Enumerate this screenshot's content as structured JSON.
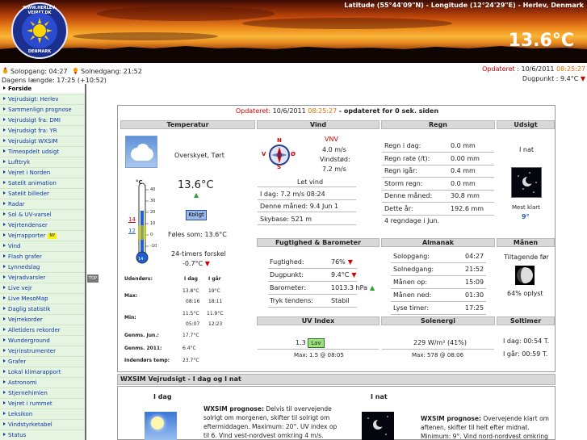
{
  "header": {
    "logo_top": "WWW.HERLEV-VEJRET.DK",
    "logo_bottom": "DENMARK",
    "geo": "Latitude (55°44'09\"N) - Longitude (12°24'29\"E) - Herlev, Denmark",
    "big_temp": "13.6°C"
  },
  "sunbar": {
    "sunrise": "Solopgang: 04:27",
    "sunset": "Solnedgang: 21:52",
    "daylength": "Dagens længde: 17:25 (+10:52)",
    "updated_label": "Opdateret :",
    "updated_date": "10/6/2011",
    "updated_time": "08:25:27",
    "dewpoint": "Dugpunkt : 9.4°C"
  },
  "sidebar": {
    "items": [
      {
        "label": "Forside",
        "active": true
      },
      {
        "label": "Vejrudsigt: Herlev"
      },
      {
        "label": "Sammenlign prognose"
      },
      {
        "label": "Vejrudsigt fra: DMI"
      },
      {
        "label": "Vejrudsigt fra: YR"
      },
      {
        "label": "Vejrudsigt WXSIM"
      },
      {
        "label": "Timeopdelt udsigt"
      },
      {
        "label": "Lufttryk"
      },
      {
        "label": "Vejret i Norden"
      },
      {
        "label": "Satelit animation"
      },
      {
        "label": "Satelit billeder"
      },
      {
        "label": "Radar"
      },
      {
        "label": "Sol & UV-varsel"
      },
      {
        "label": "Vejrtendenser"
      },
      {
        "label": "Vejrrapporter",
        "badge": "NY"
      },
      {
        "label": "Vind"
      },
      {
        "label": "Flash grafer"
      },
      {
        "label": "Lynnedslag"
      },
      {
        "label": "Vejradvarsler"
      },
      {
        "label": "Live vejr"
      },
      {
        "label": "Live MesoMap"
      },
      {
        "label": "Daglig statistik"
      },
      {
        "label": "Vejrrekorder"
      },
      {
        "label": "Alletiders rekorder"
      },
      {
        "label": "Wunderground"
      },
      {
        "label": "Vejrinstrumenter"
      },
      {
        "label": "Grafer"
      },
      {
        "label": "Lokal klimarapport"
      },
      {
        "label": "Astronomi"
      },
      {
        "label": "Stjernehimlen"
      },
      {
        "label": "Vejret i rummet"
      },
      {
        "label": "Leksikon"
      },
      {
        "label": "Vindstyrketabel"
      },
      {
        "label": "Status"
      }
    ],
    "top_button": "TOP"
  },
  "main": {
    "updated_label": "Opdateret:",
    "updated_date": "10/6/2011",
    "updated_time": "08:25:27",
    "updated_suffix": "- opdateret for 0 sek. siden",
    "headers": {
      "temperature": "Temperatur",
      "wind": "Vind",
      "rain": "Regn",
      "forecast": "Udsigt",
      "humidity": "Fugtighed & Barometer",
      "almanac": "Almanak",
      "moon": "Månen",
      "uv": "UV Index",
      "solar": "Solenergi",
      "sunhours": "Soltimer"
    },
    "temperature": {
      "condition": "Overskyet, Tørt",
      "value": "13.6°C",
      "unit_mark": "°C",
      "scale": [
        "40",
        "30",
        "20",
        "10",
        "0",
        "-10"
      ],
      "marker_hi": "14",
      "marker_lo": "12",
      "bulb": "14",
      "feel": "Koligt",
      "feels_like": "Føles som: 13.6°C",
      "forecast_label": "24-timers forskel",
      "forecast_value": "-0.7°C",
      "col_today": "I dag",
      "col_yesterday": "I går",
      "rows": [
        {
          "label": "Udendørs:"
        },
        {
          "label": "Max:",
          "today": "13.8°C",
          "today_time": "08:16",
          "yest": "19°C",
          "yest_time": "18:11"
        },
        {
          "label": "Min:",
          "today": "11.5°C",
          "today_time": "05:07",
          "yest": "11.9°C",
          "yest_time": "12:23"
        },
        {
          "label": "Genms. Jun.:",
          "today": "17.7°C"
        },
        {
          "label": "Genms. 2011:",
          "today": "6.4°C"
        },
        {
          "label": "Indendørs temp:",
          "today": "23.7°C"
        }
      ]
    },
    "wind": {
      "compass_n": "N",
      "compass_s": "S",
      "compass_v": "V",
      "compass_o": "Ø",
      "direction": "VNV",
      "speed": "4.0 m/s",
      "gust_label": "Vindstød:",
      "gust": "7.2 m/s",
      "description": "Let vind",
      "today": "I dag: 7.2 m/s 08:24",
      "month": "Denne måned: 9.4 Jun 1",
      "cloudbase": "Skybase: 521 m"
    },
    "rain": {
      "rows": [
        {
          "label": "Regn i dag:",
          "value": "0.0 mm"
        },
        {
          "label": "Regn rate (/t):",
          "value": "0.00 mm"
        },
        {
          "label": "Regn igår:",
          "value": "0.4 mm"
        },
        {
          "label": "Storm regn:",
          "value": "0.0 mm"
        },
        {
          "label": "Denne måned:",
          "value": "30.8 mm"
        },
        {
          "label": "Dette år:",
          "value": "192.6 mm"
        }
      ],
      "raindays": "4 regndage i Jun."
    },
    "forecast": {
      "period": "I nat",
      "text": "Mest klart",
      "temp": "9°"
    },
    "humidity": {
      "rows": [
        {
          "label": "Fugtighed:",
          "value": "76%",
          "trend": "down"
        },
        {
          "label": "Dugpunkt:",
          "value": "9.4°C",
          "trend": "down"
        },
        {
          "label": "Barometer:",
          "value": "1013.3 hPa",
          "trend": "up"
        },
        {
          "label": "Tryk tendens:",
          "value": "Stabil"
        }
      ]
    },
    "almanac": {
      "rows": [
        {
          "label": "Solopgang:",
          "value": "04:27"
        },
        {
          "label": "Solnedgang:",
          "value": "21:52"
        },
        {
          "label": "Månen op:",
          "value": "15:09"
        },
        {
          "label": "Månen ned:",
          "value": "01:30"
        },
        {
          "label": "Lyse timer:",
          "value": "17:25"
        }
      ]
    },
    "moon": {
      "phase": "Tiltagende før",
      "visible": "64% oplyst"
    },
    "uv": {
      "value": "1.3",
      "level": "Lav",
      "max": "Max: 1.5 @ 08:05"
    },
    "solar": {
      "value": "229 W/m² (41%)",
      "max": "Max: 578 @ 08:06"
    },
    "sunhours": {
      "today": "I dag: 00:54 T.",
      "yesterday": "I går: 00:59 T."
    }
  },
  "wxsim": {
    "bar": "WXSIM Vejrudsigt  -  I dag og I nat",
    "today_label": "I dag",
    "night_label": "I nat",
    "today_title": "WXSIM prognose:",
    "today_text": "Delvis til overvejende solrigt om morgenen, skifter til solrigt om eftermiddagen. Maximum: 20°. UV index op til 6. Vind vest-nordvest omkring 4 m/s.",
    "night_title": "WXSIM prognose:",
    "night_text": "Overvejende klart om aftenen, skifter til helt efter midnat. Minimum: 9°. Vind nord-nordvest omkring 1 m/s."
  }
}
